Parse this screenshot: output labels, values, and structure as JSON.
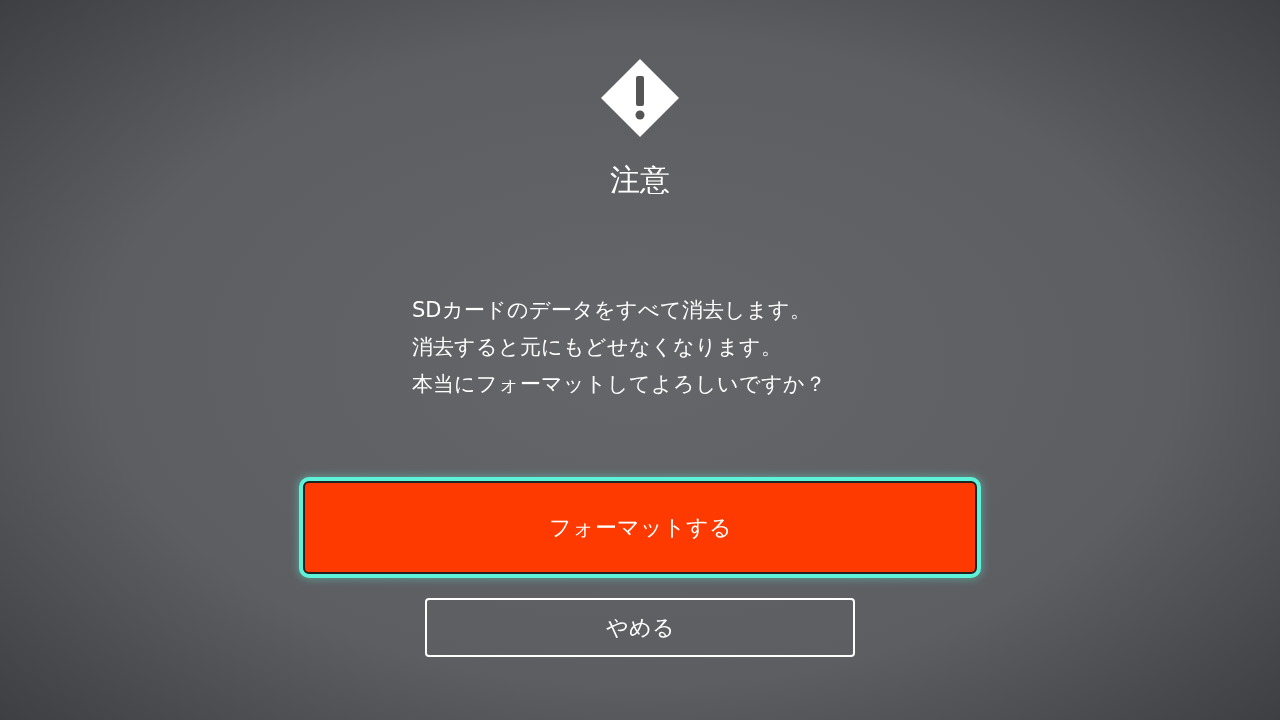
{
  "dialog": {
    "title": "注意",
    "message": [
      "SDカードのデータをすべて消去します。",
      "消去すると元にもどせなくなります。",
      "本当にフォーマットしてよろしいですか？"
    ],
    "buttons": [
      {
        "label": "フォーマットする",
        "kind": "primary",
        "focused": true
      },
      {
        "label": "やめる",
        "kind": "secondary",
        "focused": false
      }
    ]
  }
}
